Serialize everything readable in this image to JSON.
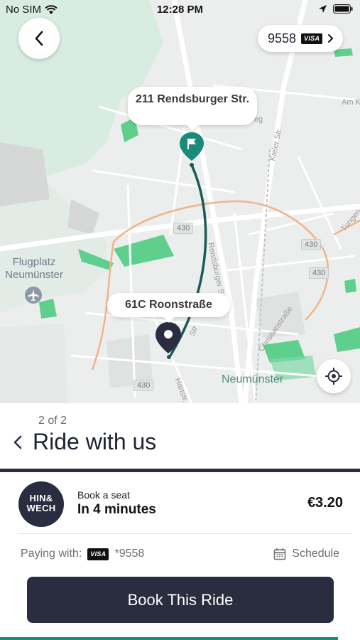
{
  "status_bar": {
    "carrier": "No SIM",
    "time": "12:28 PM"
  },
  "payment_pill": {
    "card_last4": "9558",
    "card_brand": "VISA"
  },
  "map": {
    "destination_label": "211 Rendsburger Str.",
    "origin_label": "61C Roonstraße",
    "place_airfield": "Flugplatz Neumünster",
    "place_town": "Neumünster",
    "road_badges": [
      "430",
      "430",
      "430",
      "430"
    ],
    "streets": [
      "Kieler Str.",
      "Rendsburger Str.",
      "Christianstraße",
      "Am K",
      "Tungen",
      "Hartstr.",
      "weg",
      "Str"
    ],
    "colors": {
      "route": "#1a5c55",
      "pin_destination": "#1a8a7a",
      "pin_origin": "#2a2c40",
      "park": "#5fcf8e",
      "ring_road": "#f0b48a"
    }
  },
  "sheet": {
    "step": "2 of 2",
    "title": "Ride with us",
    "ride": {
      "logo_text_line1": "HIN&",
      "logo_text_line2": "WECH",
      "subtitle": "Book a seat",
      "eta": "In 4 minutes",
      "price": "€3.20"
    },
    "payment": {
      "label": "Paying with:",
      "card_brand": "VISA",
      "card_masked": "*9558"
    },
    "schedule_label": "Schedule",
    "book_button": "Book This Ride"
  }
}
